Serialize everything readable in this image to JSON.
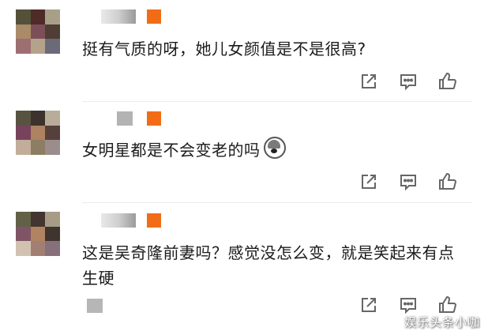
{
  "comments": [
    {
      "text": "挺有气质的呀，她儿女颜值是不是很高?",
      "avatar_colors": [
        "#54513a",
        "#4e2b27",
        "#a89f88",
        "#aa8b67",
        "#7c4f58",
        "#503d35",
        "#9d6f72",
        "#b5a28a",
        "#6a6a78"
      ]
    },
    {
      "text": "女明星都是不会变老的吗",
      "has_emoji": true,
      "avatar_colors": [
        "#585341",
        "#3c332c",
        "#b7ad99",
        "#77435c",
        "#ad8361",
        "#55403b",
        "#c1ad99",
        "#8d7d62",
        "#9b8d8b"
      ]
    },
    {
      "text": "这是吴奇隆前妻吗？感觉没怎么变，就是笑起来有点生硬",
      "avatar_colors": [
        "#626047",
        "#43352f",
        "#a99c87",
        "#7f5566",
        "#b18461",
        "#3f342e",
        "#d1c1b0",
        "#a27f73",
        "#86707b"
      ]
    }
  ],
  "actions": {
    "share_icon": "share-icon",
    "comment_icon": "comment-icon",
    "like_icon": "thumbs-up-icon"
  },
  "colors": {
    "badge": "#f26c17",
    "text": "#1b1b1b",
    "icon": "#666666"
  },
  "watermark": "娱乐头条小咖"
}
